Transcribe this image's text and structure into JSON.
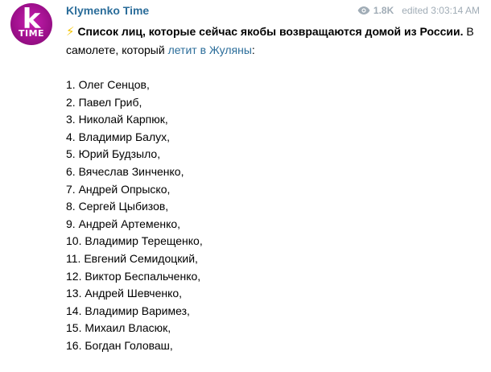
{
  "post": {
    "channel_name": "Klymenko Time",
    "views": "1.8K",
    "edited": "edited 3:03:14 AM",
    "avatar": {
      "letter": "k",
      "word": "TIME",
      "color": "#b0149c"
    },
    "lead": {
      "bold": "Список лиц, которые сейчас якобы возвращаются домой из России.",
      "text_before_link": " В самолете, который ",
      "link": "летит в Жуляны",
      "text_after_link": ":"
    },
    "list": [
      "1. Олег Сенцов,",
      "2. Павел Гриб,",
      "3. Николай Карпюк,",
      "4. Владимир Балух,",
      "5. Юрий Будзыло,",
      "6. Вячеслав Зинченко,",
      "7. Андрей Опрыско,",
      "8. Сергей Цыбизов,",
      "9. Андрей Артеменко,",
      "10. Владимир Терещенко,",
      "11. Евгений Семидоцкий,",
      "12. Виктор Беспальченко,",
      "13. Андрей Шевченко,",
      "14. Владимир Варимез,",
      "15. Михаил Власюк,",
      "16. Богдан Головаш,"
    ],
    "colors": {
      "link": "#2b6d9a",
      "meta": "#a0acb6",
      "bolt": "#f3c400"
    },
    "icons": {
      "views": "eye-icon",
      "lead": "lightning-icon"
    }
  }
}
